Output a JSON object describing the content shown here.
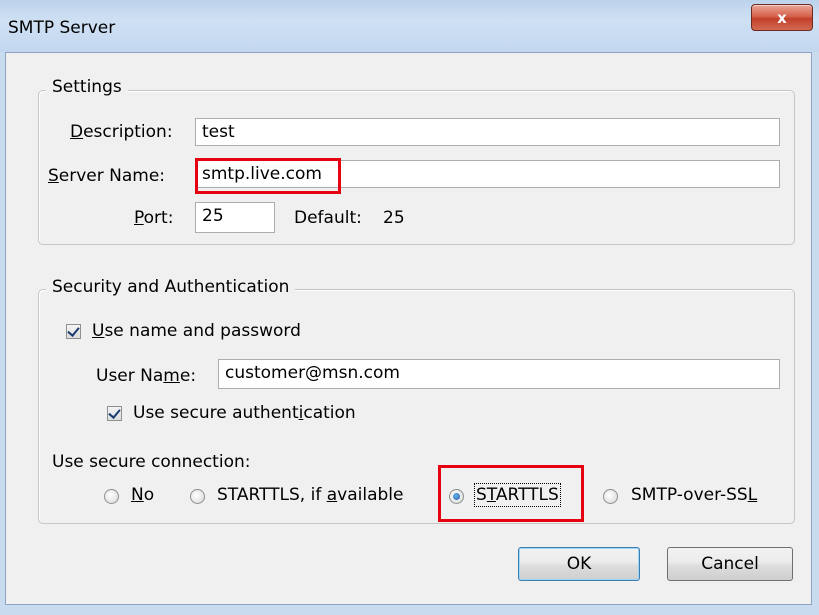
{
  "window": {
    "title": "SMTP Server",
    "close_glyph": "x"
  },
  "settings": {
    "legend": "Settings",
    "description": {
      "label_underlined": "D",
      "label_rest": "escription:",
      "value": "test"
    },
    "server_name": {
      "label_underlined": "S",
      "label_rest": "erver Name:",
      "value": "smtp.live.com"
    },
    "port": {
      "label_underlined": "P",
      "label_rest": "ort:",
      "value": "25"
    },
    "default_label": "Default:",
    "default_value": "25"
  },
  "security": {
    "legend": "Security and Authentication",
    "use_name_password": {
      "underlined": "U",
      "rest": "se name and password",
      "checked": true
    },
    "user_name": {
      "label_pre": "User Na",
      "label_underlined": "m",
      "label_post": "e:",
      "value": "customer@msn.com"
    },
    "secure_auth": {
      "pre": "Use secure authent",
      "underlined": "i",
      "post": "cation",
      "checked": true
    },
    "secure_connection_label": "Use secure connection:",
    "options": [
      {
        "pre": "",
        "underlined": "N",
        "post": "o",
        "checked": false
      },
      {
        "pre": "STARTTLS, if ",
        "underlined": "a",
        "post": "vailable",
        "checked": false
      },
      {
        "pre": "S",
        "underlined": "T",
        "post": "ARTTLS",
        "checked": true
      },
      {
        "pre": "SMTP-over-SS",
        "underlined": "L",
        "post": "",
        "checked": false
      }
    ]
  },
  "buttons": {
    "ok": "OK",
    "cancel": "Cancel"
  },
  "colors": {
    "highlight": "#e60012",
    "window_frame": "#c9dbee",
    "dialog_bg": "#f0f0f0"
  }
}
